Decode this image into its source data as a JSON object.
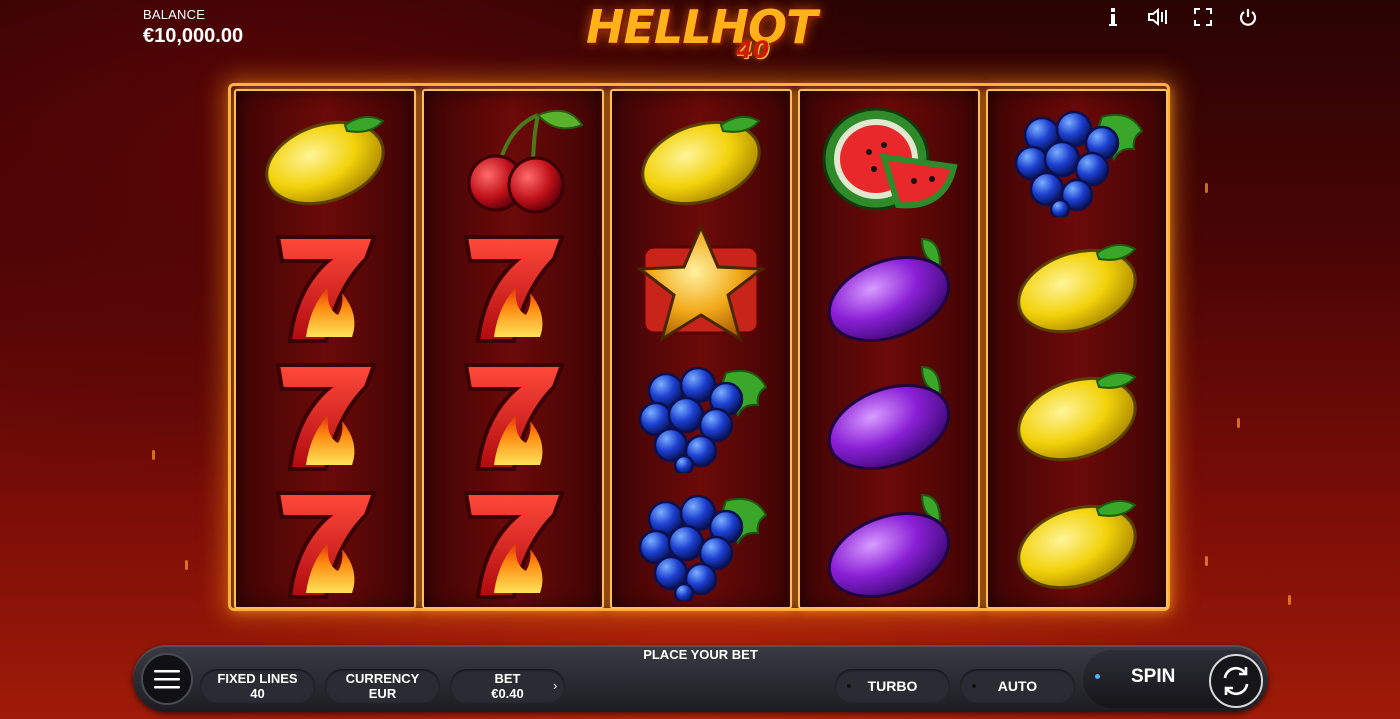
{
  "balance": {
    "label": "BALANCE",
    "value": "€10,000.00"
  },
  "logo": {
    "title": "HELLHOT",
    "subtitle": "40"
  },
  "top_icons": [
    "info-icon",
    "sound-icon",
    "fullscreen-icon",
    "power-icon"
  ],
  "reels": [
    [
      "lemon",
      "seven",
      "seven",
      "seven"
    ],
    [
      "cherry",
      "seven",
      "seven",
      "seven"
    ],
    [
      "lemon",
      "star",
      "grape",
      "grape"
    ],
    [
      "watermelon",
      "plum",
      "plum",
      "plum"
    ],
    [
      "grape",
      "lemon",
      "lemon",
      "lemon"
    ]
  ],
  "controls": {
    "message": "PLACE YOUR BET",
    "lines_label": "FIXED LINES",
    "lines_value": "40",
    "currency_label": "CURRENCY",
    "currency_value": "EUR",
    "bet_label": "BET",
    "bet_value": "€0.40",
    "turbo": "TURBO",
    "auto": "AUTO",
    "spin": "SPIN"
  },
  "colors": {
    "accent": "#ffb21a",
    "frame": "#ffbf55",
    "spin_indicator": "#4fb3ff"
  }
}
